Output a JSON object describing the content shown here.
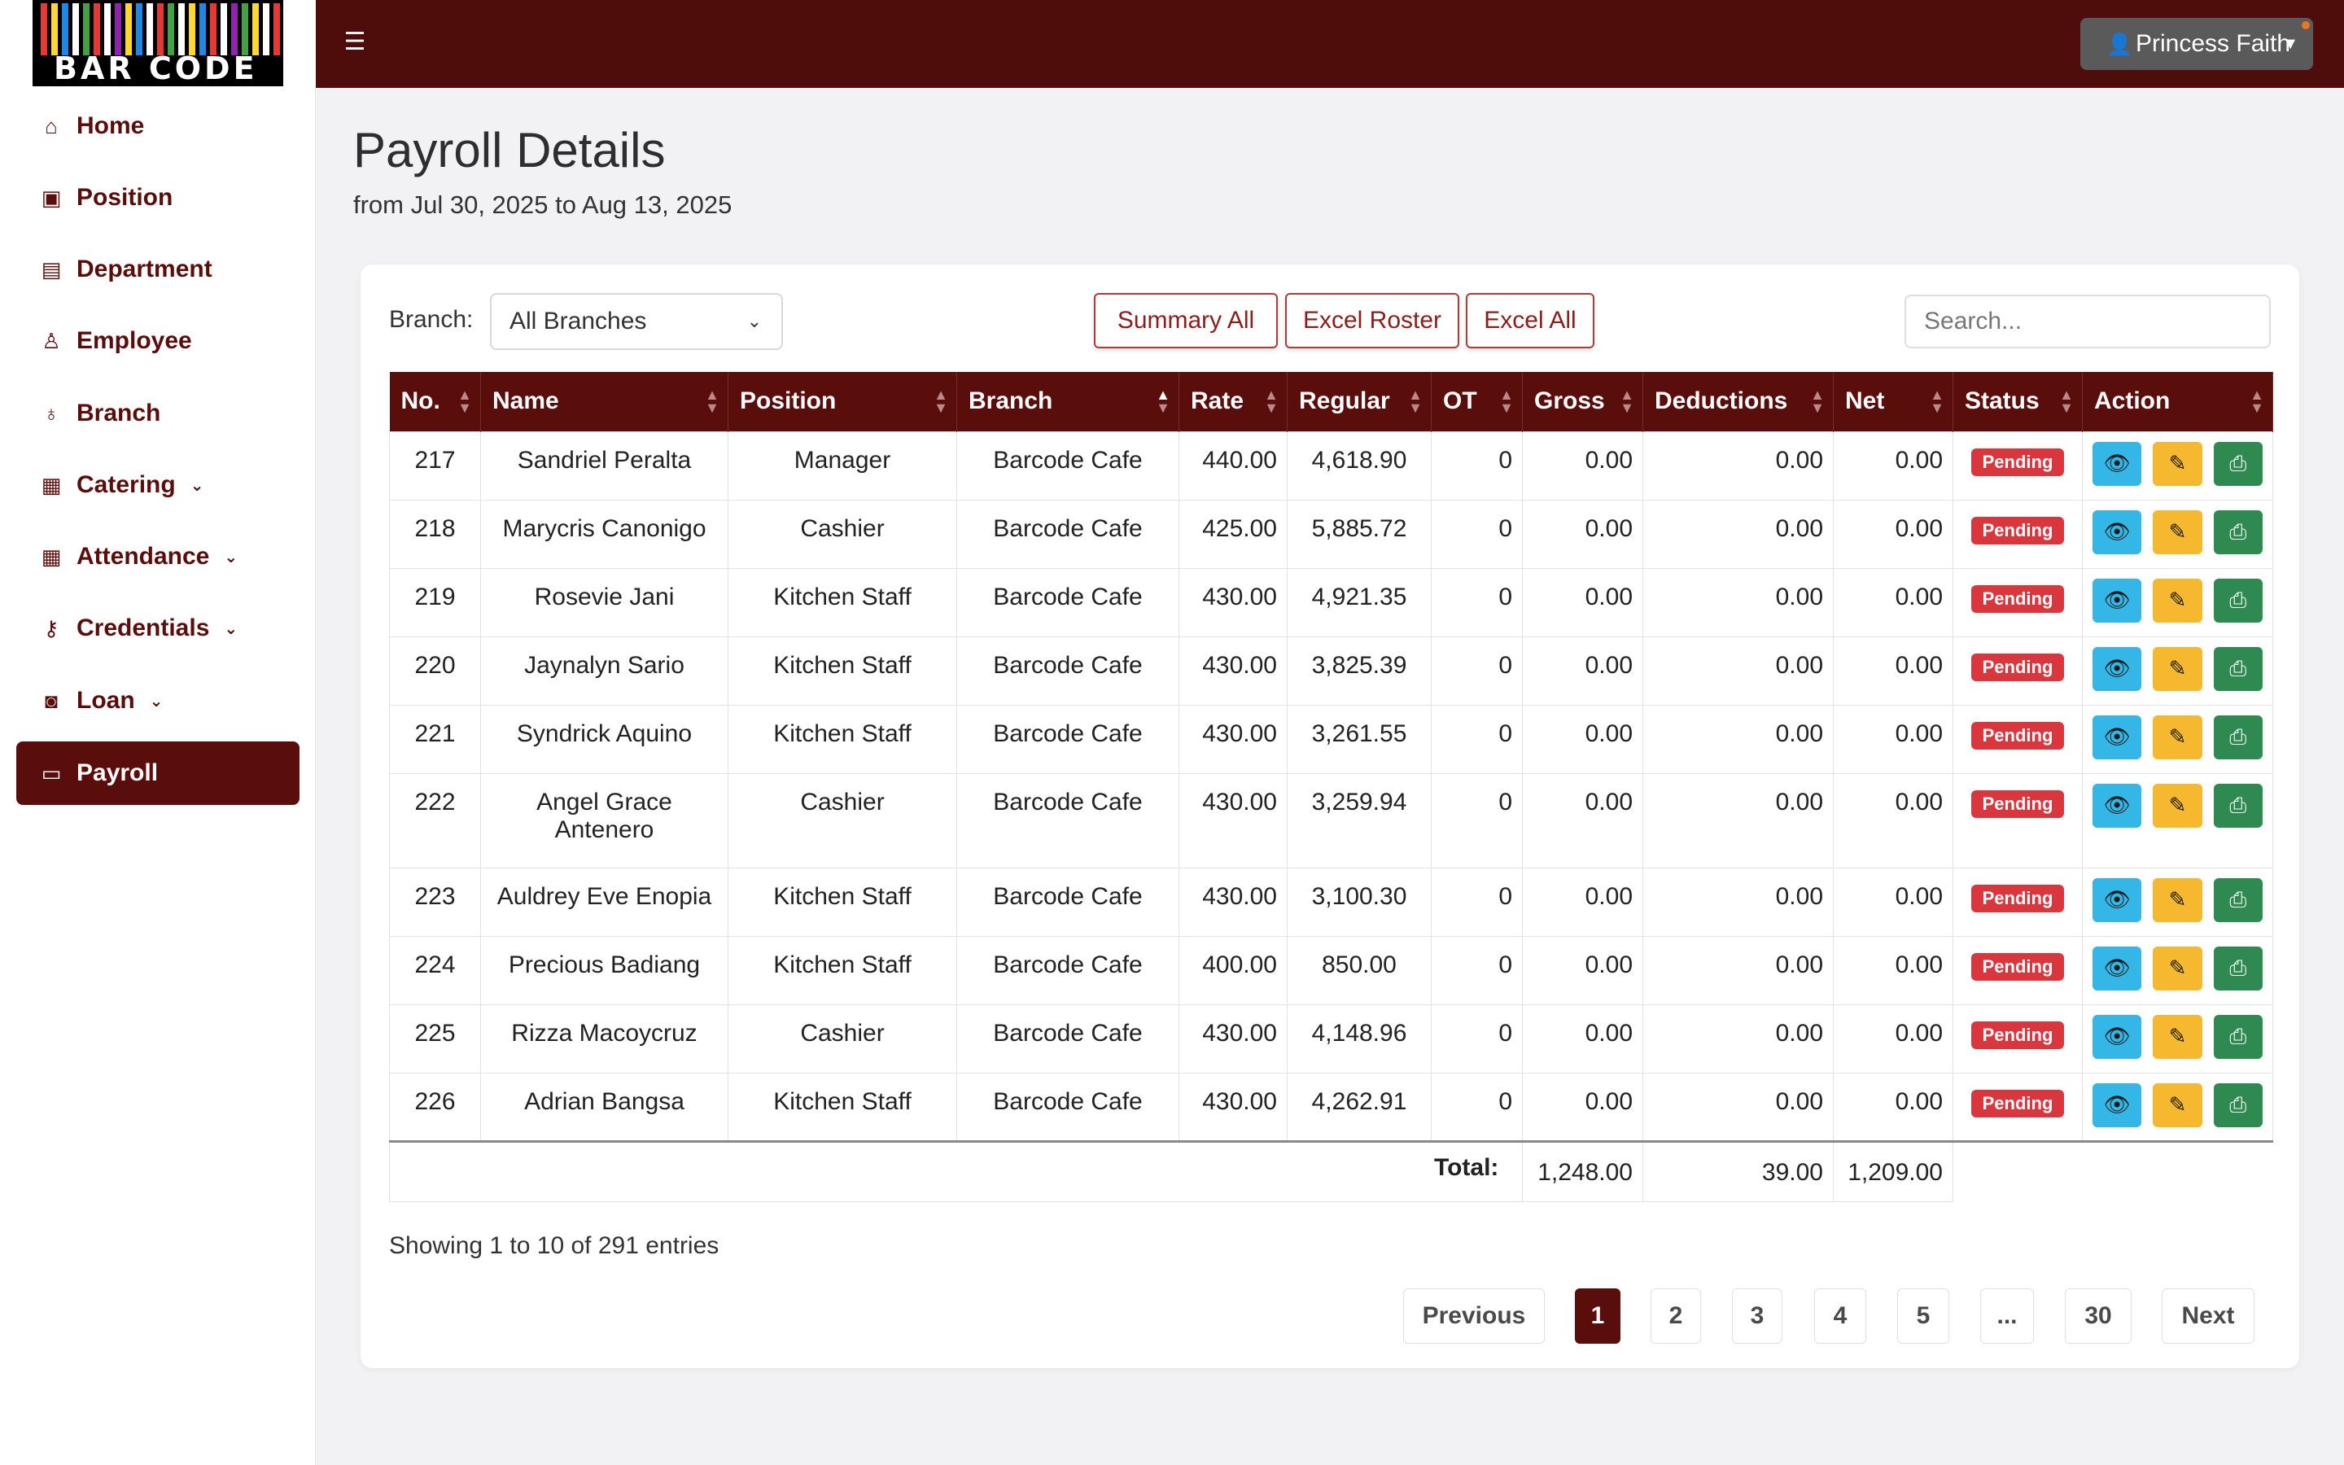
{
  "app": {
    "logo_text": "BAR CODE",
    "user_name": "Princess Faith",
    "colors": {
      "brand": "#5a0e0c",
      "topbar": "#4e0d0b",
      "pending": "#d9363e",
      "view": "#34b7e6",
      "edit": "#f5b82e",
      "print": "#2e8a50"
    }
  },
  "sidebar": {
    "items": [
      {
        "label": "Home",
        "icon": "home-icon",
        "has_submenu": false
      },
      {
        "label": "Position",
        "icon": "id-badge-icon",
        "has_submenu": false
      },
      {
        "label": "Department",
        "icon": "building-icon",
        "has_submenu": false
      },
      {
        "label": "Employee",
        "icon": "person-icon",
        "has_submenu": false
      },
      {
        "label": "Branch",
        "icon": "branch-icon",
        "has_submenu": false
      },
      {
        "label": "Catering",
        "icon": "catering-icon",
        "has_submenu": true
      },
      {
        "label": "Attendance",
        "icon": "calendar-icon",
        "has_submenu": true
      },
      {
        "label": "Credentials",
        "icon": "key-icon",
        "has_submenu": true
      },
      {
        "label": "Loan",
        "icon": "cash-icon",
        "has_submenu": true
      },
      {
        "label": "Payroll",
        "icon": "credit-card-icon",
        "has_submenu": false,
        "active": true
      }
    ]
  },
  "page": {
    "title": "Payroll Details",
    "subtitle": "from Jul 30, 2025 to Aug 13, 2025"
  },
  "toolbar": {
    "branch_label": "Branch:",
    "branch_value": "All Branches",
    "summary_all": "Summary All",
    "excel_roster": "Excel Roster",
    "excel_all": "Excel All",
    "search_placeholder": "Search..."
  },
  "table": {
    "headers": [
      "No.",
      "Name",
      "Position",
      "Branch",
      "Rate",
      "Regular",
      "OT",
      "Gross",
      "Deductions",
      "Net",
      "Status",
      "Action"
    ],
    "sorted_column": "Branch",
    "rows": [
      {
        "no": "217",
        "name": "Sandriel Peralta",
        "position": "Manager",
        "branch": "Barcode Cafe",
        "rate": "440.00",
        "regular": "4,618.90",
        "ot": "0",
        "gross": "0.00",
        "deductions": "0.00",
        "net": "0.00",
        "status": "Pending"
      },
      {
        "no": "218",
        "name": "Marycris Canonigo",
        "position": "Cashier",
        "branch": "Barcode Cafe",
        "rate": "425.00",
        "regular": "5,885.72",
        "ot": "0",
        "gross": "0.00",
        "deductions": "0.00",
        "net": "0.00",
        "status": "Pending"
      },
      {
        "no": "219",
        "name": "Rosevie Jani",
        "position": "Kitchen Staff",
        "branch": "Barcode Cafe",
        "rate": "430.00",
        "regular": "4,921.35",
        "ot": "0",
        "gross": "0.00",
        "deductions": "0.00",
        "net": "0.00",
        "status": "Pending"
      },
      {
        "no": "220",
        "name": "Jaynalyn Sario",
        "position": "Kitchen Staff",
        "branch": "Barcode Cafe",
        "rate": "430.00",
        "regular": "3,825.39",
        "ot": "0",
        "gross": "0.00",
        "deductions": "0.00",
        "net": "0.00",
        "status": "Pending"
      },
      {
        "no": "221",
        "name": "Syndrick Aquino",
        "position": "Kitchen Staff",
        "branch": "Barcode Cafe",
        "rate": "430.00",
        "regular": "3,261.55",
        "ot": "0",
        "gross": "0.00",
        "deductions": "0.00",
        "net": "0.00",
        "status": "Pending"
      },
      {
        "no": "222",
        "name": "Angel Grace Antenero",
        "position": "Cashier",
        "branch": "Barcode Cafe",
        "rate": "430.00",
        "regular": "3,259.94",
        "ot": "0",
        "gross": "0.00",
        "deductions": "0.00",
        "net": "0.00",
        "status": "Pending"
      },
      {
        "no": "223",
        "name": "Auldrey Eve Enopia",
        "position": "Kitchen Staff",
        "branch": "Barcode Cafe",
        "rate": "430.00",
        "regular": "3,100.30",
        "ot": "0",
        "gross": "0.00",
        "deductions": "0.00",
        "net": "0.00",
        "status": "Pending"
      },
      {
        "no": "224",
        "name": "Precious Badiang",
        "position": "Kitchen Staff",
        "branch": "Barcode Cafe",
        "rate": "400.00",
        "regular": "850.00",
        "ot": "0",
        "gross": "0.00",
        "deductions": "0.00",
        "net": "0.00",
        "status": "Pending"
      },
      {
        "no": "225",
        "name": "Rizza Macoycruz",
        "position": "Cashier",
        "branch": "Barcode Cafe",
        "rate": "430.00",
        "regular": "4,148.96",
        "ot": "0",
        "gross": "0.00",
        "deductions": "0.00",
        "net": "0.00",
        "status": "Pending"
      },
      {
        "no": "226",
        "name": "Adrian Bangsa",
        "position": "Kitchen Staff",
        "branch": "Barcode Cafe",
        "rate": "430.00",
        "regular": "4,262.91",
        "ot": "0",
        "gross": "0.00",
        "deductions": "0.00",
        "net": "0.00",
        "status": "Pending"
      }
    ],
    "totals": {
      "label": "Total:",
      "gross": "1,248.00",
      "deductions": "39.00",
      "net": "1,209.00"
    }
  },
  "footer": {
    "showing": "Showing 1 to 10 of 291 entries",
    "pagination": [
      "Previous",
      "1",
      "2",
      "3",
      "4",
      "5",
      "...",
      "30",
      "Next"
    ],
    "current_page": "1"
  }
}
